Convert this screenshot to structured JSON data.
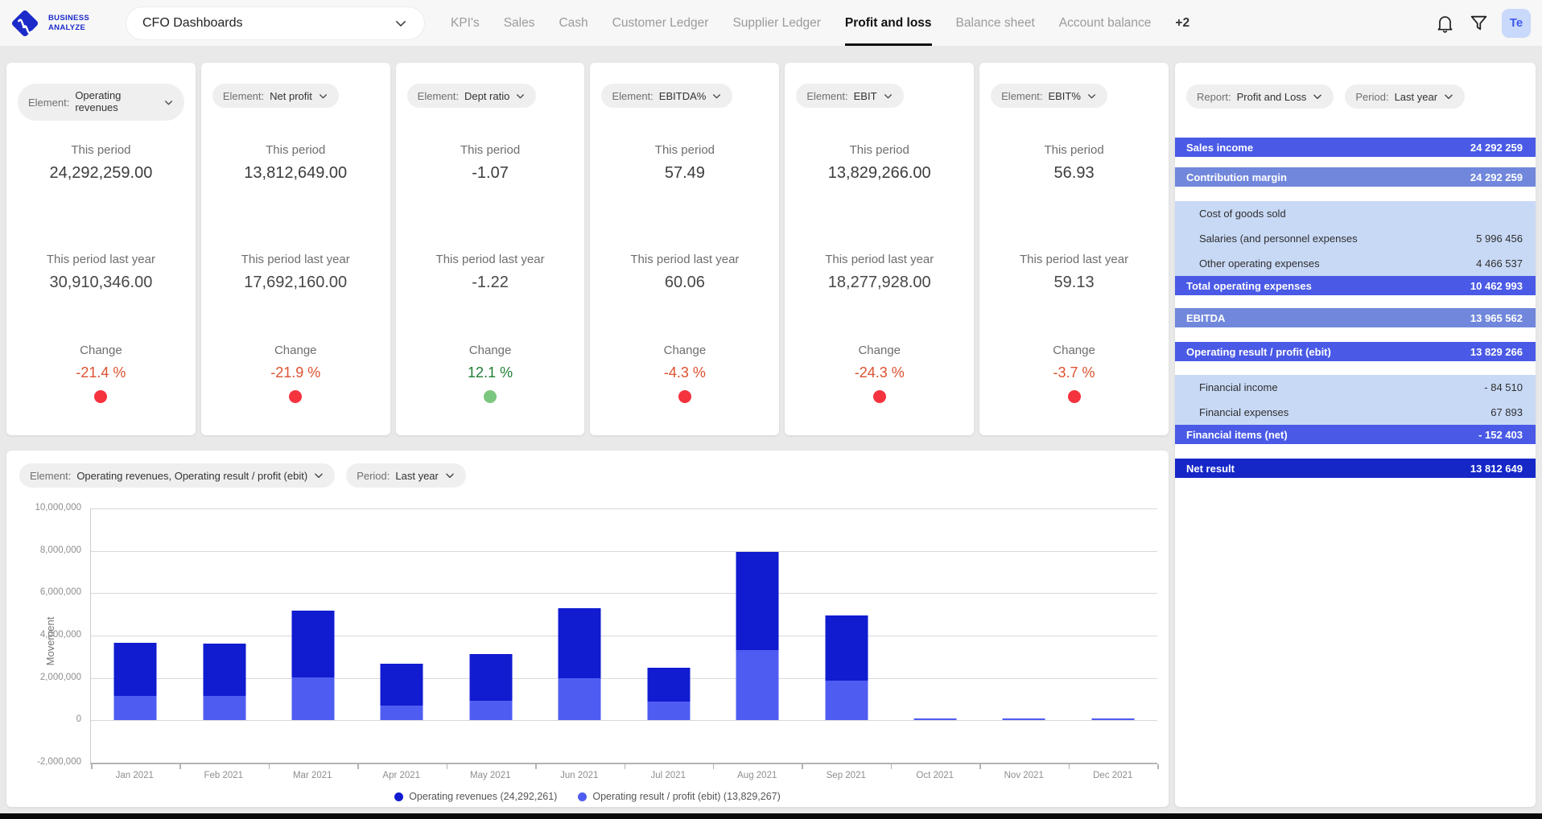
{
  "brand": {
    "line1": "BUSINESS",
    "line2": "ANALYZE"
  },
  "colors": {
    "accent_blue": "#1b2ac9",
    "row_blue": "#4a5ae6",
    "row_medium": "#7187dc",
    "row_light": "#c8d9f6",
    "row_dark": "#1527c7",
    "bar_dark": "#111bd0",
    "bar_light": "#4f5cf1",
    "change_down_text": "#dd5230",
    "change_up_text": "#1e7e34",
    "dot_down": "#f5333f",
    "dot_up": "#7cc77f"
  },
  "topbar": {
    "dashboard_selector": "CFO Dashboards",
    "tabs": [
      {
        "label": "KPI's",
        "active": false
      },
      {
        "label": "Sales",
        "active": false
      },
      {
        "label": "Cash",
        "active": false
      },
      {
        "label": "Customer Ledger",
        "active": false
      },
      {
        "label": "Supplier Ledger",
        "active": false
      },
      {
        "label": "Profit and loss",
        "active": true
      },
      {
        "label": "Balance sheet",
        "active": false
      },
      {
        "label": "Account balance",
        "active": false
      },
      {
        "label": "+2",
        "active": false,
        "type": "overflow"
      }
    ],
    "avatar": "Te"
  },
  "kpi_labels": {
    "element": "Element:",
    "this_period": "This period",
    "last_year": "This period last year",
    "change": "Change"
  },
  "kpi_cards": [
    {
      "element_value": "Operating revenues",
      "this_period": "24,292,259.00",
      "last_year": "30,910,346.00",
      "change": "-21.4 %",
      "direction": "down"
    },
    {
      "element_value": "Net profit",
      "this_period": "13,812,649.00",
      "last_year": "17,692,160.00",
      "change": "-21.9 %",
      "direction": "down"
    },
    {
      "element_value": "Dept ratio",
      "this_period": "-1.07",
      "last_year": "-1.22",
      "change": "12.1 %",
      "direction": "up"
    },
    {
      "element_value": "EBITDA%",
      "this_period": "57.49",
      "last_year": "60.06",
      "change": "-4.3 %",
      "direction": "down"
    },
    {
      "element_value": "EBIT",
      "this_period": "13,829,266.00",
      "last_year": "18,277,928.00",
      "change": "-24.3 %",
      "direction": "down"
    },
    {
      "element_value": "EBIT%",
      "this_period": "56.93",
      "last_year": "59.13",
      "change": "-3.7 %",
      "direction": "down"
    }
  ],
  "pnl_panel": {
    "report_chip": {
      "label": "Report:",
      "value": "Profit and Loss"
    },
    "period_chip": {
      "label": "Period:",
      "value": "Last year"
    },
    "rows": [
      {
        "label": "Sales income",
        "value": "24 292 259",
        "style": "blue",
        "mt": 0
      },
      {
        "label": "Contribution margin",
        "value": "24 292 259",
        "style": "medium",
        "mt": 13
      },
      {
        "type": "group",
        "mt": 18,
        "subs": [
          {
            "label": "Cost of goods sold",
            "value": ""
          },
          {
            "label": "Salaries (and personnel expenses",
            "value": "5 996 456"
          },
          {
            "label": "Other operating expenses",
            "value": "4 466 537"
          }
        ],
        "footer": {
          "label": "Total operating expenses",
          "value": "10 462 993",
          "style": "blue"
        }
      },
      {
        "label": "EBITDA",
        "value": "13 965 562",
        "style": "medium",
        "mt": 16
      },
      {
        "label": "Operating result / profit (ebit)",
        "value": "13 829 266",
        "style": "blue",
        "mt": 18
      },
      {
        "type": "group",
        "mt": 17,
        "subs": [
          {
            "label": "Financial income",
            "value": "- 84 510"
          },
          {
            "label": "Financial expenses",
            "value": "67 893"
          }
        ],
        "footer": {
          "label": "Financial items (net)",
          "value": "- 152 403",
          "style": "blue"
        }
      },
      {
        "label": "Net result",
        "value": "13 812 649",
        "style": "dark",
        "mt": 18
      }
    ]
  },
  "chart_card": {
    "element_chip": {
      "label": "Element:",
      "value": "Operating revenues, Operating result / profit (ebit)"
    },
    "period_chip": {
      "label": "Period:",
      "value": "Last year"
    }
  },
  "chart_data": {
    "type": "stacked_bar",
    "title": "",
    "ylabel": "Movement",
    "ylim": [
      -2000000,
      10000000
    ],
    "grid": true,
    "legend_position": "bottom",
    "x": [
      "Jan 2021",
      "Feb 2021",
      "Mar 2021",
      "Apr 2021",
      "May 2021",
      "Jun 2021",
      "Jul 2021",
      "Aug 2021",
      "Sep 2021",
      "Oct 2021",
      "Nov 2021",
      "Dec 2021"
    ],
    "yticks": [
      {
        "v": 10000000,
        "label": "10,000,000"
      },
      {
        "v": 8000000,
        "label": "8,000,000"
      },
      {
        "v": 6000000,
        "label": "6,000,000"
      },
      {
        "v": 4000000,
        "label": "4,000,000"
      },
      {
        "v": 2000000,
        "label": "2,000,000"
      },
      {
        "v": 0,
        "label": "0"
      },
      {
        "v": -2000000,
        "label": "-2,000,000"
      }
    ],
    "series": [
      {
        "name": "Operating result / profit (ebit)",
        "color": "#4f5cf1",
        "stack": "bottom",
        "values": [
          1150000,
          1150000,
          2000000,
          680000,
          900000,
          1950000,
          870000,
          3300000,
          1850000,
          40000,
          40000,
          40000
        ]
      },
      {
        "name": "Operating revenues",
        "color": "#111bd0",
        "stack": "top",
        "values": [
          2480000,
          2430000,
          3150000,
          1970000,
          2180000,
          3300000,
          1580000,
          4600000,
          3050000,
          0,
          0,
          0
        ]
      }
    ],
    "legend": [
      {
        "label": "Operating revenues (24,292,261)",
        "color": "#111bd0"
      },
      {
        "label": "Operating result / profit (ebit) (13,829,267)",
        "color": "#4f5cf1"
      }
    ]
  }
}
